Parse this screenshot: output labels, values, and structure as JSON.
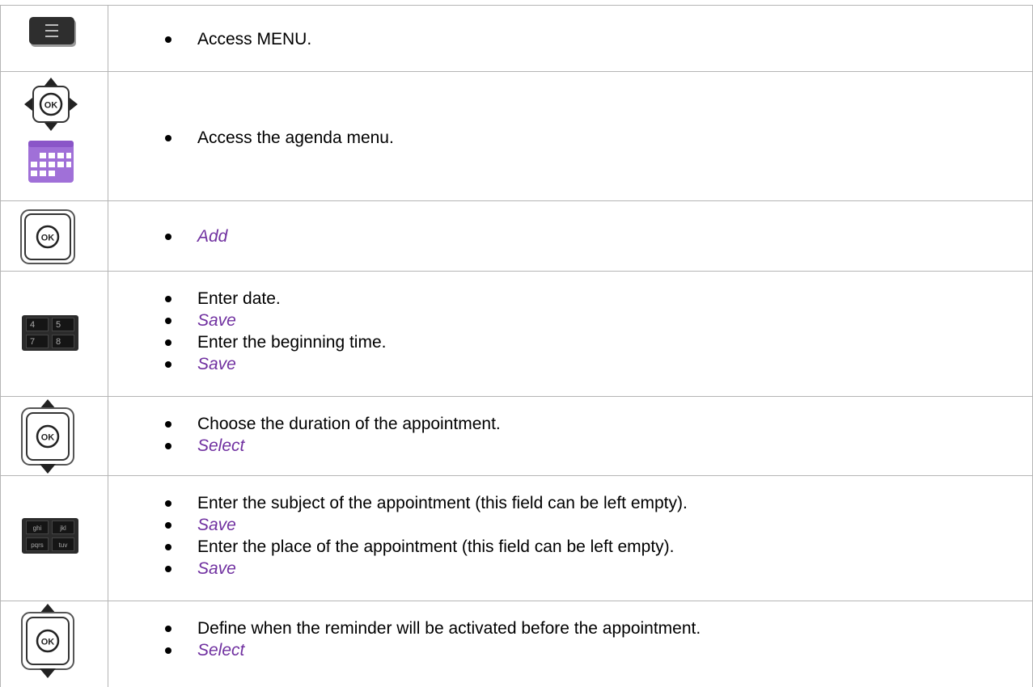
{
  "rows": [
    {
      "icon": "menu-button-icon",
      "items": [
        {
          "text": "Access MENU.",
          "italic": false
        }
      ]
    },
    {
      "icon": "navigator-calendar-icon",
      "items": [
        {
          "text": "Access the agenda menu.",
          "italic": false
        }
      ]
    },
    {
      "icon": "ok-button-icon",
      "items": [
        {
          "text": "Add",
          "italic": true
        }
      ]
    },
    {
      "icon": "numeric-keypad-icon",
      "items": [
        {
          "text": "Enter date.",
          "italic": false
        },
        {
          "text": "Save",
          "italic": true
        },
        {
          "text": "Enter the beginning time.",
          "italic": false
        },
        {
          "text": "Save",
          "italic": true
        }
      ]
    },
    {
      "icon": "navigator-up-down-icon",
      "items": [
        {
          "text": "Choose the duration of the appointment.",
          "italic": false
        },
        {
          "text": "Select",
          "italic": true
        }
      ]
    },
    {
      "icon": "alpha-keypad-icon",
      "items": [
        {
          "text": "Enter the subject of the appointment (this field can be left empty).",
          "italic": false
        },
        {
          "text": "Save",
          "italic": true
        },
        {
          "text": "Enter the place of the appointment (this field can be left empty).",
          "italic": false
        },
        {
          "text": "Save",
          "italic": true
        }
      ]
    },
    {
      "icon": "navigator-up-down-icon",
      "items": [
        {
          "text": "Define when the reminder will be activated before the appointment.",
          "italic": false
        },
        {
          "text": "Select",
          "italic": true
        }
      ]
    }
  ],
  "keypad_numeric": [
    "4",
    "5",
    "7",
    "8"
  ],
  "keypad_alpha": [
    "ghi",
    "jkl",
    "pqrs",
    "tuv"
  ],
  "ok_label": "OK",
  "colors": {
    "accent": "#7030a0",
    "calendar": "#a070d8",
    "border": "#b5b5b5"
  }
}
